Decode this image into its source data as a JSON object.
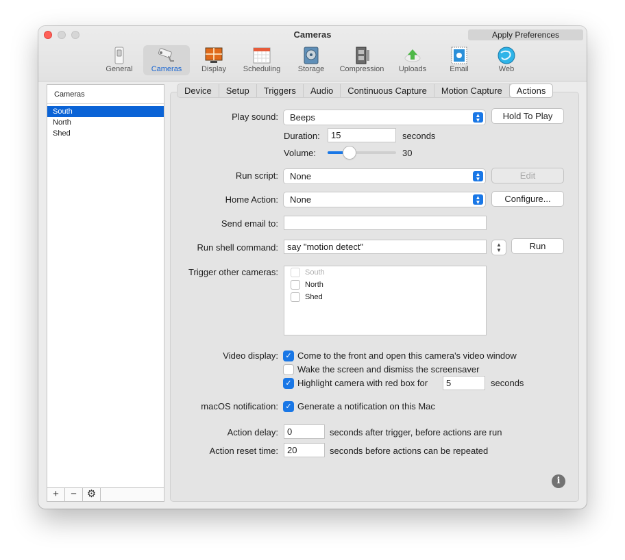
{
  "window": {
    "title": "Cameras",
    "apply_label": "Apply Preferences"
  },
  "toolbar": {
    "items": [
      {
        "label": "General",
        "icon": "general-switch-icon"
      },
      {
        "label": "Cameras",
        "icon": "security-camera-icon"
      },
      {
        "label": "Display",
        "icon": "display-grid-icon"
      },
      {
        "label": "Scheduling",
        "icon": "calendar-icon"
      },
      {
        "label": "Storage",
        "icon": "hard-drive-icon"
      },
      {
        "label": "Compression",
        "icon": "film-clamp-icon"
      },
      {
        "label": "Uploads",
        "icon": "upload-arrow-icon"
      },
      {
        "label": "Email",
        "icon": "email-stamp-icon"
      },
      {
        "label": "Web",
        "icon": "globe-icon"
      }
    ],
    "active": "Cameras"
  },
  "sidebar": {
    "header": "Cameras",
    "items": [
      "South",
      "North",
      "Shed"
    ],
    "selected": "South",
    "footer": {
      "add": "+",
      "remove": "−",
      "settings": "⚙"
    }
  },
  "tabs": [
    "Device",
    "Setup",
    "Triggers",
    "Audio",
    "Continuous Capture",
    "Motion Capture",
    "Actions"
  ],
  "active_tab": "Actions",
  "actions": {
    "play_sound": {
      "label": "Play sound:",
      "value": "Beeps",
      "button": "Hold To Play"
    },
    "duration": {
      "label": "Duration:",
      "value": "15",
      "unit": "seconds"
    },
    "volume": {
      "label": "Volume:",
      "value": "30",
      "level": 0.3
    },
    "run_script": {
      "label": "Run script:",
      "value": "None",
      "button": "Edit"
    },
    "home_action": {
      "label": "Home Action:",
      "value": "None",
      "button": "Configure..."
    },
    "send_email": {
      "label": "Send email to:",
      "value": ""
    },
    "shell_command": {
      "label": "Run shell command:",
      "value": "say \"motion detect\"",
      "button": "Run"
    },
    "trigger_cameras": {
      "label": "Trigger other cameras:",
      "items": [
        {
          "name": "South",
          "checked": false,
          "disabled": true
        },
        {
          "name": "North",
          "checked": false,
          "disabled": false
        },
        {
          "name": "Shed",
          "checked": false,
          "disabled": false
        }
      ]
    },
    "video_display": {
      "label": "Video display:",
      "front": {
        "text": "Come to the front and open this camera's video window",
        "checked": true
      },
      "wake": {
        "text": "Wake the screen and dismiss the screensaver",
        "checked": false
      },
      "highlight": {
        "text": "Highlight camera with red box for",
        "checked": true,
        "value": "5",
        "unit": "seconds"
      }
    },
    "notification": {
      "label": "macOS notification:",
      "text": "Generate a notification on this Mac",
      "checked": true
    },
    "action_delay": {
      "label": "Action delay:",
      "value": "0",
      "suffix": "seconds after trigger, before actions are run"
    },
    "reset_time": {
      "label": "Action reset time:",
      "value": "20",
      "suffix": "seconds before actions can be repeated"
    }
  },
  "colors": {
    "accent": "#1977e6",
    "selection": "#0a63d6",
    "close": "#fe5f57"
  }
}
